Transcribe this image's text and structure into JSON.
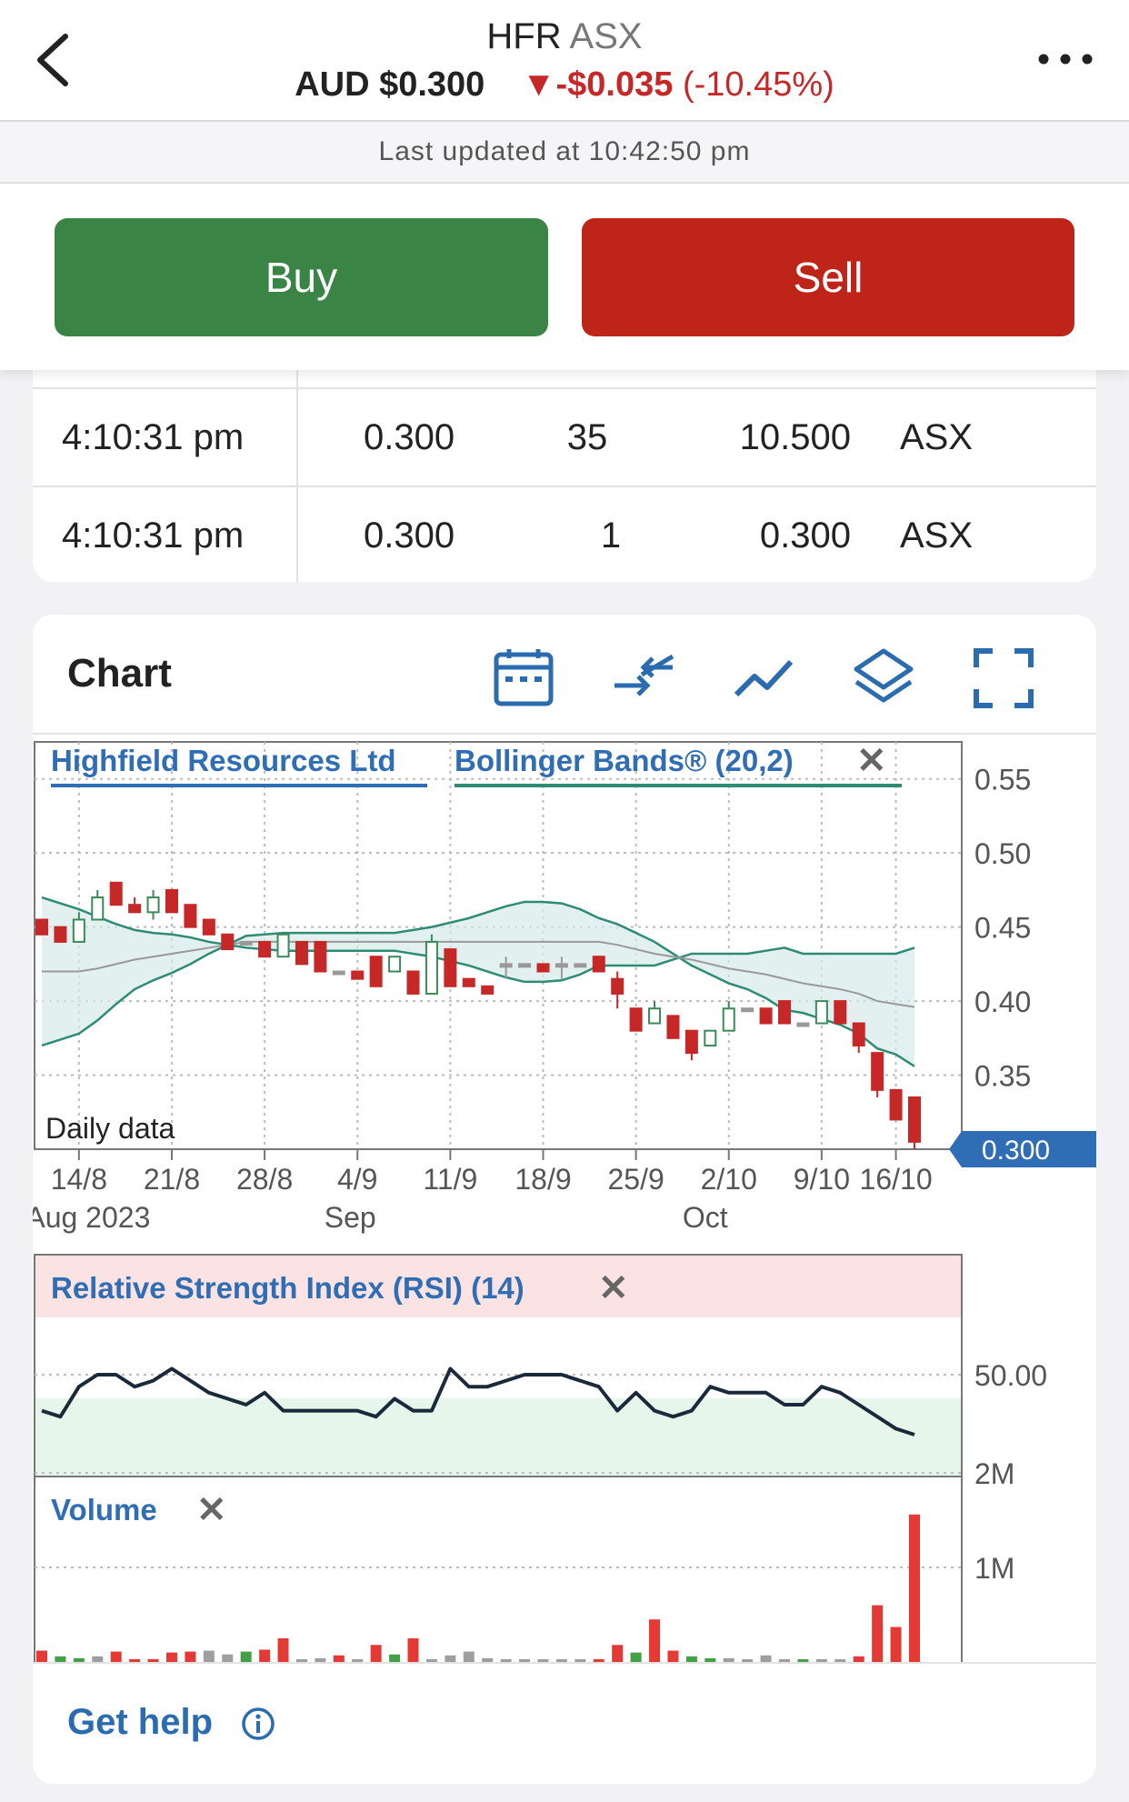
{
  "header": {
    "symbol": "HFR",
    "exchange": "ASX",
    "price": "AUD $0.300",
    "change": "▼-$0.035",
    "change_pct": "(-10.45%)"
  },
  "updated": "Last updated at 10:42:50 pm",
  "actions": {
    "buy": "Buy",
    "sell": "Sell"
  },
  "trades": [
    {
      "time": "4:10:31 pm",
      "price": "0.300",
      "qty": "35",
      "value": "10.500",
      "market": "ASX"
    },
    {
      "time": "4:10:31 pm",
      "price": "0.300",
      "qty": "1",
      "value": "0.300",
      "market": "ASX"
    }
  ],
  "chart_card": {
    "title": "Chart",
    "help": "Get help",
    "icons": [
      "calendar-icon",
      "compare-icon",
      "line-chart-icon",
      "layers-icon",
      "fullscreen-icon"
    ]
  },
  "colors": {
    "up": "#3a8a5a",
    "down": "#c62828",
    "flat": "#999999",
    "band": "#2e8b76",
    "price_tag": "#2f6db5",
    "rsi_line": "#1b2a3a"
  },
  "chart_data": [
    {
      "type": "candlestick",
      "series_label": "Highfield Resources Ltd",
      "indicator_label": "Bollinger Bands® (20,2)",
      "frequency_label": "Daily data",
      "last_price_label": "0.300",
      "yticks": [
        "0.55",
        "0.50",
        "0.45",
        "0.40",
        "0.35"
      ],
      "ylim": [
        0.3,
        0.575
      ],
      "xticks": [
        "14/8",
        "21/8",
        "28/8",
        "4/9",
        "11/9",
        "18/9",
        "25/9",
        "2/10",
        "9/10",
        "16/10"
      ],
      "month_labels": [
        "Aug 2023",
        "Sep",
        "Oct"
      ],
      "grid": true,
      "ohlc": [
        [
          0.455,
          0.455,
          0.445,
          0.445
        ],
        [
          0.45,
          0.45,
          0.44,
          0.44
        ],
        [
          0.44,
          0.46,
          0.44,
          0.455
        ],
        [
          0.455,
          0.475,
          0.455,
          0.47
        ],
        [
          0.48,
          0.48,
          0.465,
          0.465
        ],
        [
          0.465,
          0.47,
          0.46,
          0.46
        ],
        [
          0.46,
          0.475,
          0.455,
          0.47
        ],
        [
          0.475,
          0.475,
          0.46,
          0.46
        ],
        [
          0.465,
          0.465,
          0.45,
          0.45
        ],
        [
          0.455,
          0.455,
          0.445,
          0.445
        ],
        [
          0.445,
          0.445,
          0.435,
          0.435
        ],
        [
          0.44,
          0.44,
          0.44,
          0.44
        ],
        [
          0.44,
          0.44,
          0.43,
          0.43
        ],
        [
          0.43,
          0.445,
          0.43,
          0.445
        ],
        [
          0.44,
          0.44,
          0.425,
          0.425
        ],
        [
          0.44,
          0.44,
          0.42,
          0.42
        ],
        [
          0.42,
          0.42,
          0.42,
          0.42
        ],
        [
          0.42,
          0.42,
          0.415,
          0.415
        ],
        [
          0.43,
          0.43,
          0.41,
          0.41
        ],
        [
          0.42,
          0.43,
          0.42,
          0.43
        ],
        [
          0.42,
          0.42,
          0.405,
          0.405
        ],
        [
          0.405,
          0.445,
          0.405,
          0.44
        ],
        [
          0.435,
          0.435,
          0.41,
          0.41
        ],
        [
          0.415,
          0.415,
          0.41,
          0.41
        ],
        [
          0.41,
          0.41,
          0.405,
          0.405
        ],
        [
          0.425,
          0.43,
          0.415,
          0.425
        ],
        [
          0.425,
          0.425,
          0.425,
          0.425
        ],
        [
          0.425,
          0.425,
          0.42,
          0.42
        ],
        [
          0.425,
          0.43,
          0.415,
          0.425
        ],
        [
          0.425,
          0.425,
          0.425,
          0.425
        ],
        [
          0.43,
          0.43,
          0.42,
          0.42
        ],
        [
          0.415,
          0.42,
          0.395,
          0.405
        ],
        [
          0.395,
          0.395,
          0.38,
          0.38
        ],
        [
          0.385,
          0.4,
          0.385,
          0.395
        ],
        [
          0.39,
          0.39,
          0.375,
          0.375
        ],
        [
          0.38,
          0.38,
          0.36,
          0.365
        ],
        [
          0.37,
          0.38,
          0.37,
          0.38
        ],
        [
          0.38,
          0.4,
          0.38,
          0.395
        ],
        [
          0.395,
          0.395,
          0.395,
          0.395
        ],
        [
          0.395,
          0.395,
          0.385,
          0.385
        ],
        [
          0.4,
          0.4,
          0.385,
          0.385
        ],
        [
          0.385,
          0.385,
          0.385,
          0.385
        ],
        [
          0.385,
          0.4,
          0.385,
          0.4
        ],
        [
          0.4,
          0.4,
          0.385,
          0.385
        ],
        [
          0.385,
          0.385,
          0.365,
          0.37
        ],
        [
          0.365,
          0.365,
          0.335,
          0.34
        ],
        [
          0.34,
          0.34,
          0.32,
          0.32
        ],
        [
          0.335,
          0.335,
          0.3,
          0.305
        ]
      ],
      "upper_band": [
        0.47,
        0.466,
        0.462,
        0.457,
        0.452,
        0.448,
        0.446,
        0.445,
        0.443,
        0.44,
        0.438,
        0.436,
        0.435,
        0.434,
        0.434,
        0.434,
        0.434,
        0.434,
        0.434,
        0.434,
        0.432,
        0.43,
        0.427,
        0.424,
        0.42,
        0.416,
        0.413,
        0.413,
        0.414,
        0.418,
        0.424,
        0.424,
        0.424,
        0.424,
        0.428,
        0.432,
        0.432,
        0.432,
        0.432,
        0.434,
        0.436,
        0.432,
        0.432,
        0.432,
        0.432,
        0.432,
        0.432,
        0.436
      ],
      "middle_band": [
        0.42,
        0.42,
        0.42,
        0.422,
        0.425,
        0.428,
        0.43,
        0.432,
        0.434,
        0.436,
        0.438,
        0.44,
        0.44,
        0.44,
        0.44,
        0.44,
        0.44,
        0.44,
        0.44,
        0.44,
        0.44,
        0.44,
        0.44,
        0.44,
        0.44,
        0.44,
        0.44,
        0.44,
        0.44,
        0.44,
        0.44,
        0.438,
        0.435,
        0.432,
        0.43,
        0.428,
        0.425,
        0.422,
        0.42,
        0.418,
        0.415,
        0.412,
        0.41,
        0.408,
        0.405,
        0.4,
        0.398,
        0.396
      ],
      "lower_band": [
        0.37,
        0.374,
        0.378,
        0.387,
        0.398,
        0.408,
        0.414,
        0.419,
        0.425,
        0.432,
        0.438,
        0.444,
        0.445,
        0.446,
        0.446,
        0.446,
        0.446,
        0.446,
        0.446,
        0.446,
        0.448,
        0.45,
        0.453,
        0.456,
        0.46,
        0.464,
        0.467,
        0.467,
        0.466,
        0.462,
        0.456,
        0.452,
        0.446,
        0.44,
        0.432,
        0.424,
        0.418,
        0.412,
        0.408,
        0.402,
        0.394,
        0.392,
        0.388,
        0.384,
        0.378,
        0.368,
        0.364,
        0.356
      ]
    },
    {
      "type": "line",
      "title": "Relative Strength Index (RSI) (14)",
      "ytick": "50.00",
      "values": [
        44,
        43,
        48,
        50,
        50,
        48,
        49,
        51,
        49,
        47,
        46,
        45,
        47,
        44,
        44,
        44,
        44,
        44,
        43,
        46,
        44,
        44,
        51,
        48,
        48,
        49,
        50,
        50,
        50,
        49,
        48,
        44,
        47,
        44,
        43,
        44,
        48,
        47,
        47,
        47,
        45,
        45,
        48,
        47,
        45,
        43,
        41,
        40
      ]
    },
    {
      "type": "bar",
      "title": "Volume",
      "yticks": [
        "2M",
        "1M"
      ],
      "ylim": [
        0,
        2000000
      ],
      "values": [
        120000,
        60000,
        40000,
        60000,
        110000,
        30000,
        30000,
        100000,
        110000,
        120000,
        80000,
        110000,
        130000,
        250000,
        30000,
        40000,
        70000,
        30000,
        180000,
        80000,
        250000,
        30000,
        70000,
        110000,
        40000,
        30000,
        30000,
        30000,
        30000,
        30000,
        30000,
        180000,
        100000,
        450000,
        120000,
        60000,
        40000,
        40000,
        30000,
        70000,
        30000,
        30000,
        30000,
        30000,
        60000,
        600000,
        370000,
        1560000
      ],
      "colors": [
        "d",
        "u",
        "u",
        "f",
        "d",
        "d",
        "d",
        "d",
        "d",
        "f",
        "f",
        "u",
        "d",
        "d",
        "f",
        "f",
        "d",
        "f",
        "d",
        "u",
        "d",
        "f",
        "f",
        "f",
        "f",
        "f",
        "f",
        "f",
        "f",
        "f",
        "d",
        "d",
        "u",
        "d",
        "d",
        "u",
        "u",
        "f",
        "f",
        "f",
        "f",
        "u",
        "f",
        "f",
        "d",
        "d",
        "d",
        "d"
      ]
    }
  ]
}
